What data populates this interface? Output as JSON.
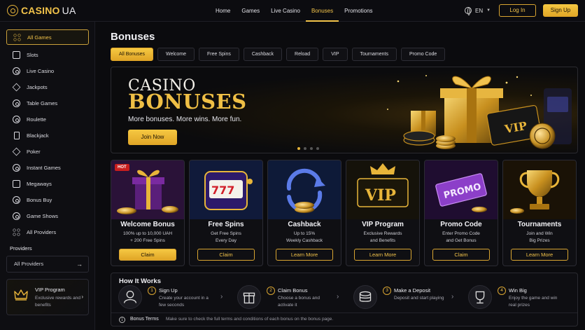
{
  "brand": {
    "name": "CASINO",
    "suffix": "UA"
  },
  "nav": [
    {
      "label": "Home"
    },
    {
      "label": "Games"
    },
    {
      "label": "Live Casino"
    },
    {
      "label": "Bonuses",
      "active": true
    },
    {
      "label": "Promotions"
    }
  ],
  "lang": "EN",
  "auth": {
    "login": "Log In",
    "signup": "Sign Up"
  },
  "sidebar": {
    "items": [
      {
        "label": "All Games",
        "icon": "grid-icon",
        "active": true
      },
      {
        "label": "Slots",
        "icon": "slot-icon"
      },
      {
        "label": "Live Casino",
        "icon": "dealer-icon"
      },
      {
        "label": "Jackpots",
        "icon": "jackpot-icon"
      },
      {
        "label": "Table Games",
        "icon": "chip-icon"
      },
      {
        "label": "Roulette",
        "icon": "roulette-icon"
      },
      {
        "label": "Blackjack",
        "icon": "card-icon"
      },
      {
        "label": "Poker",
        "icon": "poker-icon"
      },
      {
        "label": "Instant Games",
        "icon": "instant-icon"
      },
      {
        "label": "Megaways",
        "icon": "megaways-icon"
      },
      {
        "label": "Bonus Buy",
        "icon": "bonus-buy-icon"
      },
      {
        "label": "Game Shows",
        "icon": "game-show-icon"
      },
      {
        "label": "All Providers",
        "icon": "providers-icon"
      }
    ],
    "providers_label": "Providers",
    "providers_select": "All Providers",
    "vip": {
      "title": "VIP Program",
      "sub": "Exclusive rewards and benefits"
    }
  },
  "page": {
    "title": "Bonuses"
  },
  "tabs": [
    {
      "label": "All Bonuses",
      "active": true
    },
    {
      "label": "Welcome"
    },
    {
      "label": "Free Spins"
    },
    {
      "label": "Cashback"
    },
    {
      "label": "Reload"
    },
    {
      "label": "VIP"
    },
    {
      "label": "Tournaments"
    },
    {
      "label": "Promo Code"
    }
  ],
  "hero": {
    "line1": "CASINO",
    "line2": "BONUSES",
    "sub": "More bonuses. More wins. More fun.",
    "cta": "Join Now",
    "badge": "VIP"
  },
  "cards": [
    {
      "title": "Welcome Bonus",
      "desc1": "100% up to 10,000 UAH",
      "desc2": "+ 200 Free Spins",
      "btn": "Claim",
      "solid": true,
      "badge": "HOT"
    },
    {
      "title": "Free Spins",
      "desc1": "Get Free Spins",
      "desc2": "Every Day",
      "btn": "Claim",
      "art_text": "777"
    },
    {
      "title": "Cashback",
      "desc1": "Up to 15%",
      "desc2": "Weekly Cashback",
      "btn": "Learn More"
    },
    {
      "title": "VIP Program",
      "desc1": "Exclusive Rewards",
      "desc2": "and Benefits",
      "btn": "Learn More",
      "art_text": "VIP"
    },
    {
      "title": "Promo Code",
      "desc1": "Enter Promo Code",
      "desc2": "and Get Bonus",
      "btn": "Claim",
      "art_text": "PROMO"
    },
    {
      "title": "Tournaments",
      "desc1": "Join and Win",
      "desc2": "Big Prizes",
      "btn": "Learn More"
    }
  ],
  "how": {
    "title": "How It Works",
    "steps": [
      {
        "num": "1",
        "title": "Sign Up",
        "desc": "Create your account in a few seconds",
        "icon": "user-icon"
      },
      {
        "num": "2",
        "title": "Claim Bonus",
        "desc": "Choose a bonus and activate it",
        "icon": "gift-icon"
      },
      {
        "num": "3",
        "title": "Make a Deposit",
        "desc": "Deposit and start playing",
        "icon": "coins-icon"
      },
      {
        "num": "4",
        "title": "Win Big",
        "desc": "Enjoy the game and win real prizes",
        "icon": "trophy-icon"
      }
    ],
    "terms_label": "Bonus Terms",
    "terms_text": "Make sure to check the full terms and conditions of each bonus on the bonus page."
  },
  "colors": {
    "accent": "#f2c34a",
    "hot": "#c81e1e",
    "bg": "#0b0b0e"
  }
}
